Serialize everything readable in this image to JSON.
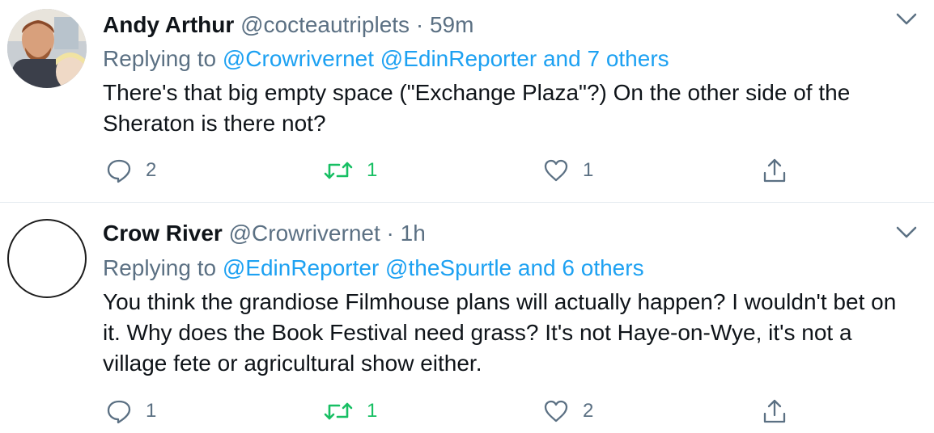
{
  "tweets": [
    {
      "author_name": "Andy Arthur",
      "author_handle": "@cocteautriplets",
      "separator": "·",
      "time": "59m",
      "replying_prefix": "Replying to",
      "replying_handles": "@Crowrivernet @EdinReporter",
      "and_others": "and 7 others",
      "text": "There's that big empty space (\"Exchange Plaza\"?) On the other side of the Sheraton is there not?",
      "reply_count": "2",
      "retweet_count": "1",
      "like_count": "1"
    },
    {
      "author_name": "Crow River",
      "author_handle": "@Crowrivernet",
      "separator": "·",
      "time": "1h",
      "replying_prefix": "Replying to",
      "replying_handles": "@EdinReporter @theSpurtle",
      "and_others": "and 6 others",
      "text": "You think the grandiose Filmhouse plans will actually happen? I wouldn't bet on it. Why does the Book Festival need grass? It's not Haye-on-Wye, it's not a village fete or agricultural show either.",
      "reply_count": "1",
      "retweet_count": "1",
      "like_count": "2"
    }
  ],
  "colors": {
    "link": "#1da1f2",
    "muted": "#5b7083",
    "retweet_active": "#17bf63",
    "divider": "#e6ecf0"
  },
  "icons": [
    "reply-icon",
    "retweet-icon",
    "like-icon",
    "share-icon",
    "chevron-down-icon"
  ]
}
